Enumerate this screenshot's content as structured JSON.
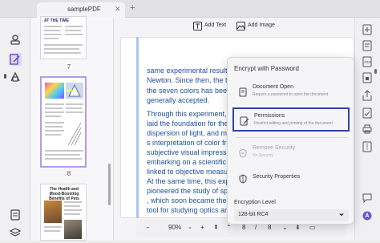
{
  "tab": {
    "title": "samplePDF",
    "close": "✕",
    "add": "+"
  },
  "toolbar": {
    "add_text": "Add Text",
    "add_image": "Add Image"
  },
  "thumbnails": [
    {
      "heading": "AT THE TIME",
      "label": "7"
    },
    {
      "label": "8"
    },
    {
      "heading": "The Health and Mood-Boosting Benefits of Pets"
    }
  ],
  "document": {
    "lines": [
      "same experimental results as",
      "Newton. Since then, the theory of",
      "the seven colors has been",
      "generally accepted.",
      "",
      "Through this experiment, Newto",
      "laid the foundation for the theor",
      "dispersion of light, and made pe",
      "s interpretation of color free fro",
      "subjective visual impressions, th",
      "embarking on a scientific track",
      "linked to objective measuremen",
      "At the same time, this experime",
      "pioneered the study of spectros",
      ", which soon became the main",
      "tool for studying optics and the",
      "structure of matter."
    ]
  },
  "popup": {
    "title": "Encrypt with Password",
    "items": [
      {
        "title": "Document Open",
        "subtitle": "Require a password to open the document"
      },
      {
        "title": "Permissions",
        "subtitle": "Restrict editing and printing of the document"
      },
      {
        "title": "Remove Security",
        "subtitle": "No Security"
      },
      {
        "title": "Security Properties",
        "subtitle": ""
      }
    ],
    "encryption_label": "Encryption Level",
    "encryption_value": "128-bit RC4"
  },
  "bottom": {
    "zoom": "90%",
    "page_current": "8",
    "page_separator": "/",
    "page_total": "8"
  },
  "colors": {
    "accent": "#b59be8",
    "highlight": "#2e43a6",
    "doc_text": "#1f4e9a"
  }
}
